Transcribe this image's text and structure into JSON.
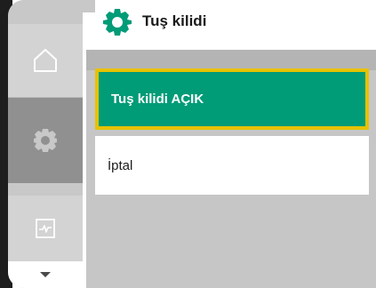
{
  "header": {
    "title": "Tuş kilidi",
    "icon": "gear-icon",
    "accent_color": "#009b77"
  },
  "sidebar": {
    "items": [
      {
        "name": "home",
        "icon": "home-icon"
      },
      {
        "name": "settings",
        "icon": "gear-icon",
        "selected": true
      },
      {
        "name": "diagnostics",
        "icon": "pulse-icon"
      },
      {
        "name": "more",
        "icon": "chevron-down-icon"
      }
    ]
  },
  "menu": {
    "items": [
      {
        "label": "Tuş kilidi AÇIK",
        "focused": true
      },
      {
        "label": "İptal",
        "focused": false
      }
    ],
    "focus_color": "#e6c200"
  }
}
